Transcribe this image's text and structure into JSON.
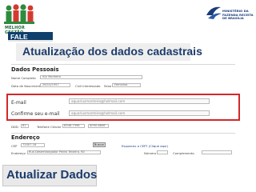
{
  "header": {
    "left_logo_tag": "MELHOR GESTÃO",
    "right_logo_caption": "MINISTÉRIO DA FAZENDA\nRECEITA DE BRASÍLIA"
  },
  "page": {
    "title_tab": "FALE CONOSCO",
    "heading": "Atualização dos dados cadastrais",
    "bottom_label": "Atualizar Dados"
  },
  "form": {
    "section_personal": "Dados Pessoais",
    "name_label": "Nome Completo",
    "name_value": "Ary Monteiro",
    "birth_label": "Data de Nascimento",
    "birth_value": "26/10/1957",
    "civil_label": "Civil Interessado",
    "sex_label": "Sexo",
    "sex_value": "Feminino",
    "email_label": "E-mail",
    "email_value": "aquariusmonteiro@hotmail.com",
    "confirm_email_label": "Confirme seu e-mail",
    "confirm_email_value": "aquariusmonteiro@hotmail.com",
    "ddd_label": "DDD",
    "ddd_value": "61",
    "phone_label": "Telefone Celular",
    "phone_value": "8346-7398",
    "phone2_value": "4090-6846",
    "section_address": "Endereço",
    "cep_label": "CEP",
    "cep_value": "72007-16",
    "search_button": "Buscar",
    "cep_hint": "Esqueceu o CEP? (Clique aqui)",
    "address_label": "Endereço",
    "address_value": "Rua Desembargador Pedro Teixeira, 60",
    "number_label": "Número",
    "complement_label": "Complemento"
  }
}
